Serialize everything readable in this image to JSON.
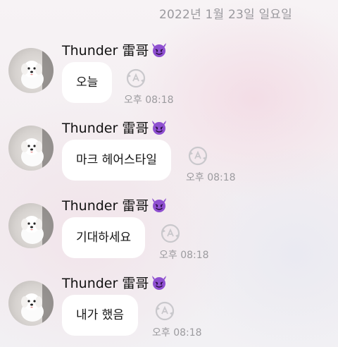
{
  "date_header": "2022년 1월 23일 일요일",
  "messages": [
    {
      "sender": "Thunder 雷哥",
      "text": "오늘",
      "time": "오후 08:18"
    },
    {
      "sender": "Thunder 雷哥",
      "text": "마크 헤어스타일",
      "time": "오후 08:18"
    },
    {
      "sender": "Thunder 雷哥",
      "text": "기대하세요",
      "time": "오후 08:18"
    },
    {
      "sender": "Thunder 雷哥",
      "text": "내가 했음",
      "time": "오후 08:18"
    }
  ],
  "icons": {
    "avatar": "white-dog-avatar",
    "sender_emoji": "smiling-devil-emoji",
    "translate": "translate-icon"
  },
  "colors": {
    "bubble": "#ffffff",
    "time_text": "#9c9b9f",
    "devil_emoji": "#8e4fd0"
  }
}
